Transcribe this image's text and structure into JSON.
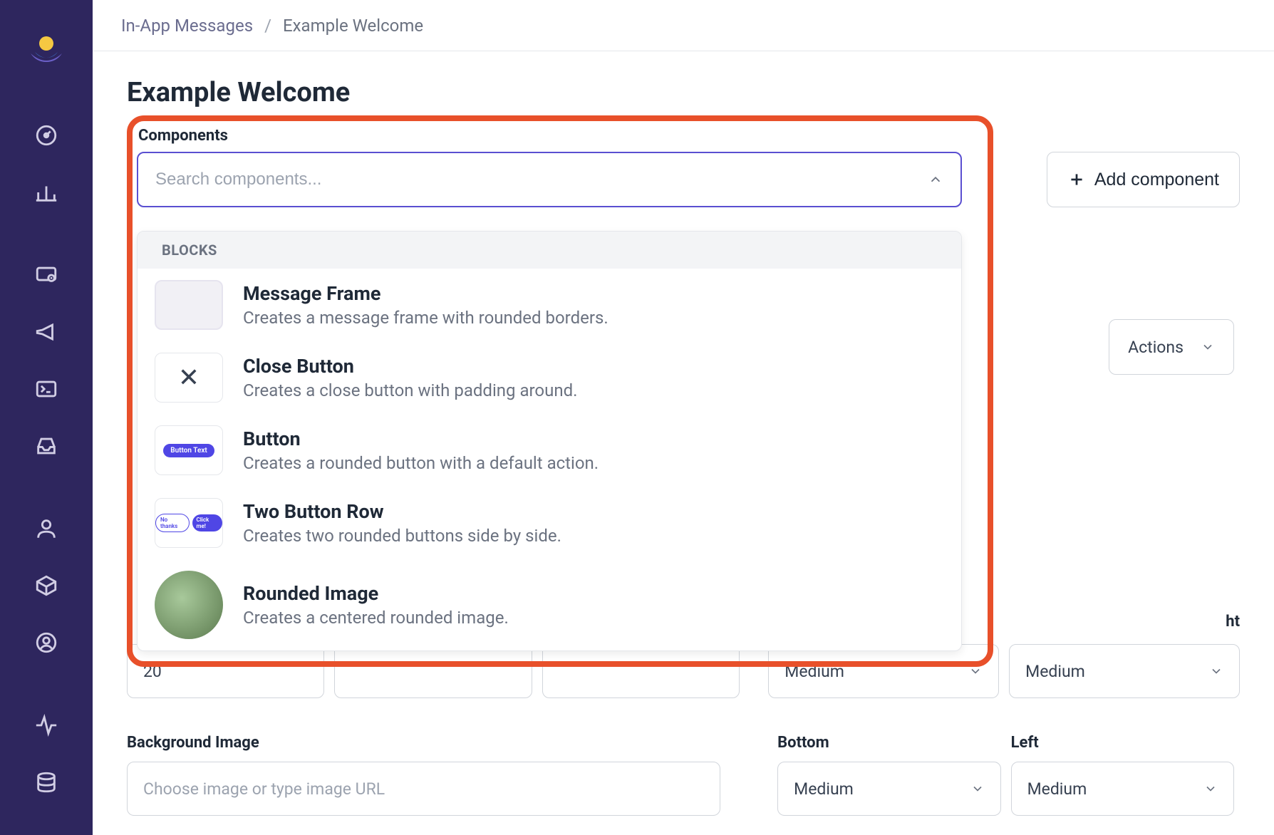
{
  "breadcrumb": {
    "parent": "In-App Messages",
    "current": "Example Welcome"
  },
  "page_title": "Example Welcome",
  "components": {
    "label": "Components",
    "search_placeholder": "Search components...",
    "add_button": "Add component",
    "group_label": "BLOCKS",
    "items": [
      {
        "name": "Message Frame",
        "desc": "Creates a message frame with rounded borders.",
        "thumb": "frame"
      },
      {
        "name": "Close Button",
        "desc": "Creates a close button with padding around.",
        "thumb": "x"
      },
      {
        "name": "Button",
        "desc": "Creates a rounded button with a default action.",
        "thumb": "button",
        "thumb_text": "Button Text"
      },
      {
        "name": "Two Button Row",
        "desc": "Creates two rounded buttons side by side.",
        "thumb": "two",
        "thumb_left": "No thanks",
        "thumb_right": "Click me!"
      },
      {
        "name": "Rounded Image",
        "desc": "Creates a centered rounded image.",
        "thumb": "round"
      }
    ]
  },
  "actions_label": "Actions",
  "fields": {
    "peek_value": "20",
    "peek_right_label": "ht",
    "right_col_peek": "Medium",
    "medium": "Medium",
    "bg_image_label": "Background Image",
    "bg_image_placeholder": "Choose image or type image URL",
    "bottom_label": "Bottom",
    "left_label": "Left"
  }
}
